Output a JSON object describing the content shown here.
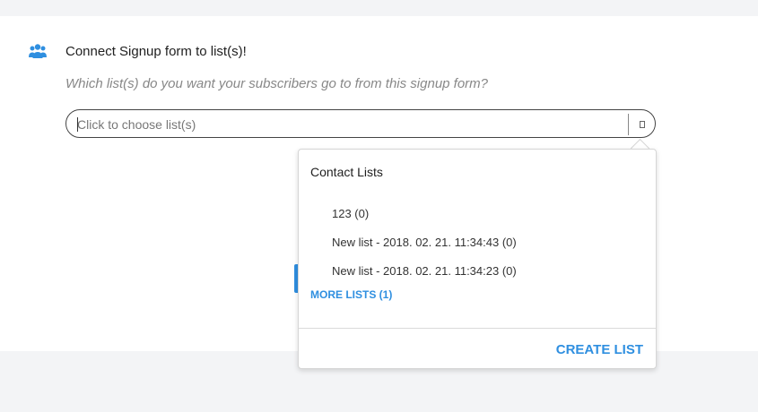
{
  "section": {
    "icon": "users-icon",
    "title": "Connect Signup form to list(s)!",
    "subtitle": "Which list(s) do you want your subscribers go to from this signup form?"
  },
  "list_select": {
    "placeholder": "Click to choose list(s)",
    "toggle_icon": "dropdown-toggle-icon"
  },
  "dropdown": {
    "title": "Contact Lists",
    "items": [
      {
        "label": "123 (0)"
      },
      {
        "label": "New list - 2018. 02. 21. 11:34:43 (0)"
      },
      {
        "label": "New list - 2018. 02. 21. 11:34:23 (0)"
      }
    ],
    "more_label": "MORE LISTS (1)",
    "create_label": "CREATE LIST"
  },
  "colors": {
    "accent": "#2f8fe0",
    "background": "#f3f4f6",
    "panel": "#ffffff"
  }
}
